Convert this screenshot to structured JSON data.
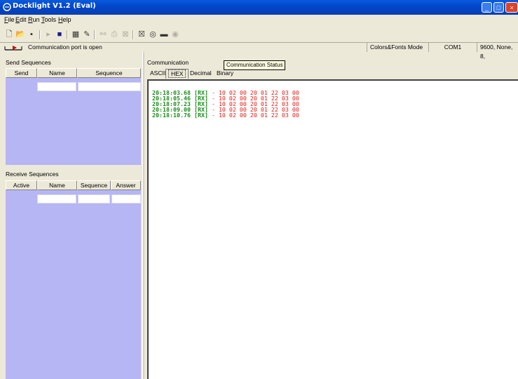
{
  "window": {
    "title": "Docklight V1.2 (Eval)",
    "min_glyph": "_",
    "max_glyph": "□",
    "close_glyph": "×"
  },
  "menu": {
    "items": [
      {
        "label": "File",
        "access": "F",
        "rest": "ile"
      },
      {
        "label": "Edit",
        "access": "E",
        "rest": "dit"
      },
      {
        "label": "Run",
        "access": "R",
        "rest": "un"
      },
      {
        "label": "Tools",
        "access": "T",
        "rest": "ools"
      },
      {
        "label": "Help",
        "access": "H",
        "rest": "elp"
      }
    ]
  },
  "toolbar": {
    "icons": [
      "new-file-icon",
      "open-folder-icon",
      "save-icon",
      "play-icon",
      "stop-icon",
      "properties-icon",
      "wrench-icon",
      "binoculars-icon",
      "print-icon",
      "clear-icon",
      "snapshot-icon",
      "capture-icon",
      "logging-icon"
    ]
  },
  "status": {
    "port_message": "Communication port is open",
    "mode": "Colors&Fonts Mode",
    "port": "COM1",
    "settings": "9600, None, 8,"
  },
  "send_sequences": {
    "title": "Send Sequences",
    "columns": [
      "Send",
      "Name",
      "Sequence"
    ]
  },
  "receive_sequences": {
    "title": "Receive Sequences",
    "columns": [
      "Active",
      "Name",
      "Sequence",
      "Answer"
    ]
  },
  "communication": {
    "title": "Communication",
    "tooltip": "Communication Status",
    "tabs": [
      "ASCII",
      "HEX",
      "Decimal",
      "Binary"
    ],
    "selected_tab": "HEX",
    "log": [
      {
        "time": "20:18:03.68",
        "dir": "[RX]",
        "sep": "-",
        "data": "10 02 00 20 01 22 03 00"
      },
      {
        "time": "20:18:05.46",
        "dir": "[RX]",
        "sep": "-",
        "data": "10 02 00 20 01 22 03 00"
      },
      {
        "time": "20:18:07.23",
        "dir": "[RX]",
        "sep": "-",
        "data": "10 02 00 20 01 22 03 00"
      },
      {
        "time": "20:18:09.00",
        "dir": "[RX]",
        "sep": "-",
        "data": "10 02 00 20 01 22 03 00"
      },
      {
        "time": "20:18:10.76",
        "dir": "[RX]",
        "sep": "-",
        "data": "10 02 00 20 01 22 03 00"
      }
    ]
  },
  "colors": {
    "titlebar": "#0047cc",
    "grid_blue": "#b6b6f4",
    "timestamp": "#1a8c1a",
    "data": "#e0201a"
  }
}
